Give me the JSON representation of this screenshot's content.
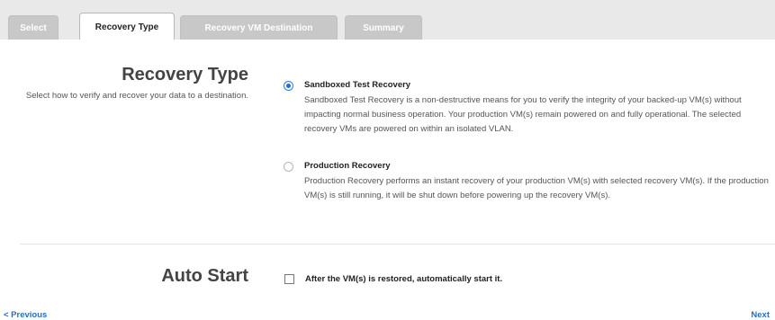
{
  "tabs": [
    {
      "label": "Select",
      "active": false
    },
    {
      "label": "Recovery Type",
      "active": true
    },
    {
      "label": "Recovery VM Destination",
      "active": false
    },
    {
      "label": "Summary",
      "active": false
    }
  ],
  "recovery_type": {
    "title": "Recovery Type",
    "description": "Select how to verify and recover your data to a destination.",
    "options": [
      {
        "label": "Sandboxed Test Recovery",
        "selected": true,
        "description": "Sandboxed Test Recovery is a non-destructive means for you to verify the integrity of your backed-up VM(s) without impacting normal business operation. Your production VM(s) remain powered on and fully operational. The selected recovery VMs are powered on within an isolated VLAN."
      },
      {
        "label": "Production Recovery",
        "selected": false,
        "description": "Production Recovery performs an instant recovery of your production VM(s) with selected recovery VM(s). If the production VM(s) is still running, it will be shut down before powering up the recovery VM(s)."
      }
    ]
  },
  "auto_start": {
    "title": "Auto Start",
    "checkbox_label": "After the VM(s) is restored, automatically start it.",
    "checked": false
  },
  "nav": {
    "previous": "< Previous",
    "next": "Next"
  },
  "colors": {
    "accent": "#1e6fd0",
    "link": "#2a6fbf",
    "tab_inactive": "#c8c8c8",
    "tabbar_bg": "#e9e9e9"
  }
}
